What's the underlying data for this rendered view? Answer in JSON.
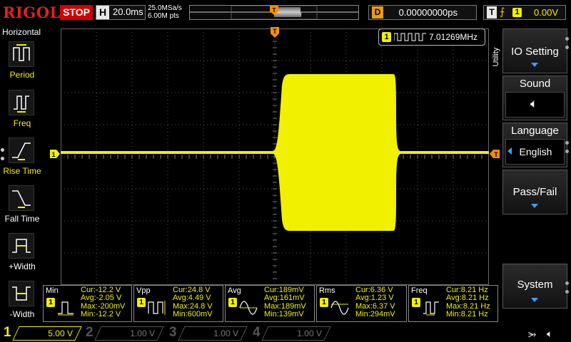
{
  "header": {
    "brand": "RIGOL",
    "run_state": "STOP",
    "horizontal_key": "H",
    "timebase": "20.0ms",
    "sample_rate": "25.0MSa/s",
    "memory_depth": "6.00M pts",
    "trigger_pos_marker": "T",
    "delay_key": "D",
    "delay_value": "0.00000000ps",
    "trigger_key": "T",
    "trigger_source": "1",
    "trigger_level": "0.00V"
  },
  "left_panel": {
    "title": "Horizontal",
    "items": [
      {
        "label": "Period",
        "icon": "period-icon"
      },
      {
        "label": "Freq",
        "icon": "freq-icon"
      },
      {
        "label": "Rise Time",
        "icon": "rise-time-icon"
      },
      {
        "label": "Fall Time",
        "icon": "fall-time-icon"
      },
      {
        "label": "+Width",
        "icon": "positive-width-icon"
      },
      {
        "label": "-Width",
        "icon": "negative-width-icon"
      }
    ]
  },
  "screen": {
    "trigger_marker": "T",
    "channel_marker": "1",
    "trigger_level_marker": "T",
    "freq_counter": {
      "channel": "1",
      "value": "7.01269MHz"
    }
  },
  "right_menu": {
    "tab": "Utility",
    "buttons": [
      {
        "label": "IO Setting"
      },
      {
        "label": "Sound",
        "icon": "speaker-icon"
      },
      {
        "label": "Language",
        "value": "English"
      },
      {
        "label": "Pass/Fail"
      },
      {
        "label": "System"
      }
    ]
  },
  "measurements": [
    {
      "name": "Min",
      "channel": "1",
      "cur": "Cur:-12.2 V",
      "avg": "Avg:-2.05 V",
      "max": "Max:-200mV",
      "min": "Min:-12.2 V"
    },
    {
      "name": "Vpp",
      "channel": "1",
      "cur": "Cur:24.8 V",
      "avg": "Avg:4.49 V",
      "max": "Max:24.8 V",
      "min": "Min:600mV"
    },
    {
      "name": "Avg",
      "channel": "1",
      "cur": "Cur:189mV",
      "avg": "Avg:161mV",
      "max": "Max:189mV",
      "min": "Min:139mV"
    },
    {
      "name": "Rms",
      "channel": "1",
      "cur": "Cur:6.36 V",
      "avg": "Avg:1.23 V",
      "max": "Max:6.37 V",
      "min": "Min:294mV"
    },
    {
      "name": "Freq",
      "channel": "1",
      "cur": "Cur:8.21 Hz",
      "avg": "Avg:8.21 Hz",
      "max": "Max:8.21 Hz",
      "min": "Min:8.21 Hz"
    }
  ],
  "channels": [
    {
      "num": "1",
      "scale": "5.00 V",
      "color": "#f0f000",
      "active": true
    },
    {
      "num": "2",
      "scale": "1.00 V",
      "color": "#00c8ff",
      "active": false
    },
    {
      "num": "3",
      "scale": "1.00 V",
      "color": "#ff00ff",
      "active": false
    },
    {
      "num": "4",
      "scale": "1.00 V",
      "color": "#3a7bff",
      "active": false
    }
  ],
  "colors": {
    "ch1": "#f0f000",
    "trigger": "#ff8c00",
    "accent": "#39a0ff",
    "stop": "#d40000"
  }
}
